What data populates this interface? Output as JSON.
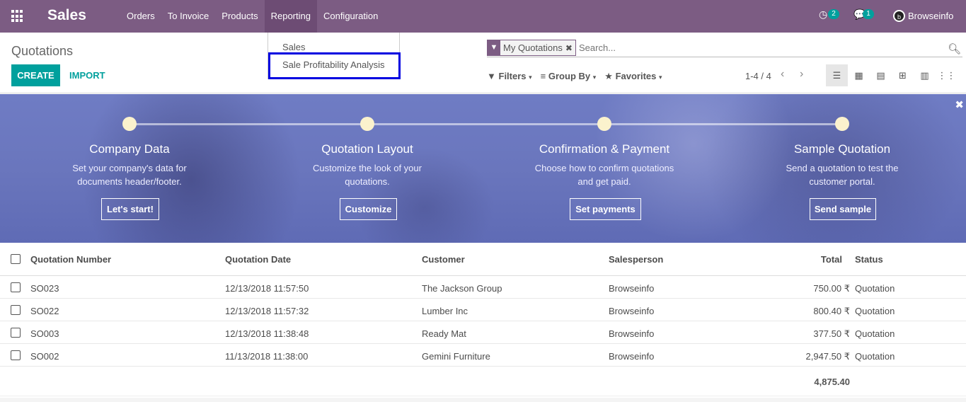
{
  "topbar": {
    "brand": "Sales",
    "menu": [
      "Orders",
      "To Invoice",
      "Products",
      "Reporting",
      "Configuration"
    ],
    "activities_count": "2",
    "messages_count": "1",
    "avatar_initial": "b",
    "user": "Browseinfo"
  },
  "reporting_menu": {
    "items": [
      "Sales",
      "Sale Profitability Analysis"
    ]
  },
  "control": {
    "title": "Quotations",
    "create_label": "CREATE",
    "import_label": "IMPORT",
    "facet_label": "My Quotations",
    "search_placeholder": "Search...",
    "filters_label": "Filters",
    "groupby_label": "Group By",
    "favorites_label": "Favorites",
    "pager": "1-4 / 4"
  },
  "banner": {
    "steps": [
      {
        "title": "Company Data",
        "desc_line1": "Set your company's data for",
        "desc_line2": "documents header/footer.",
        "button": "Let's start!"
      },
      {
        "title": "Quotation Layout",
        "desc_line1": "Customize the look of your",
        "desc_line2": "quotations.",
        "button": "Customize"
      },
      {
        "title": "Confirmation & Payment",
        "desc_line1": "Choose how to confirm quotations",
        "desc_line2": "and get paid.",
        "button": "Set payments"
      },
      {
        "title": "Sample Quotation",
        "desc_line1": "Send a quotation to test the",
        "desc_line2": "customer portal.",
        "button": "Send sample"
      }
    ]
  },
  "table": {
    "columns": [
      "Quotation Number",
      "Quotation Date",
      "Customer",
      "Salesperson",
      "Total",
      "Status"
    ],
    "rows": [
      {
        "number": "SO023",
        "date": "12/13/2018 11:57:50",
        "customer": "The Jackson Group",
        "salesperson": "Browseinfo",
        "total": "750.00 ₹",
        "status": "Quotation"
      },
      {
        "number": "SO022",
        "date": "12/13/2018 11:57:32",
        "customer": "Lumber Inc",
        "salesperson": "Browseinfo",
        "total": "800.40 ₹",
        "status": "Quotation"
      },
      {
        "number": "SO003",
        "date": "12/13/2018 11:38:48",
        "customer": "Ready Mat",
        "salesperson": "Browseinfo",
        "total": "377.50 ₹",
        "status": "Quotation"
      },
      {
        "number": "SO002",
        "date": "11/13/2018 11:38:00",
        "customer": "Gemini Furniture",
        "salesperson": "Browseinfo",
        "total": "2,947.50 ₹",
        "status": "Quotation"
      }
    ],
    "grand_total": "4,875.40"
  },
  "colors": {
    "topbar": "#7c5c83",
    "accent": "#00a09d",
    "highlight": "#0000e0"
  }
}
